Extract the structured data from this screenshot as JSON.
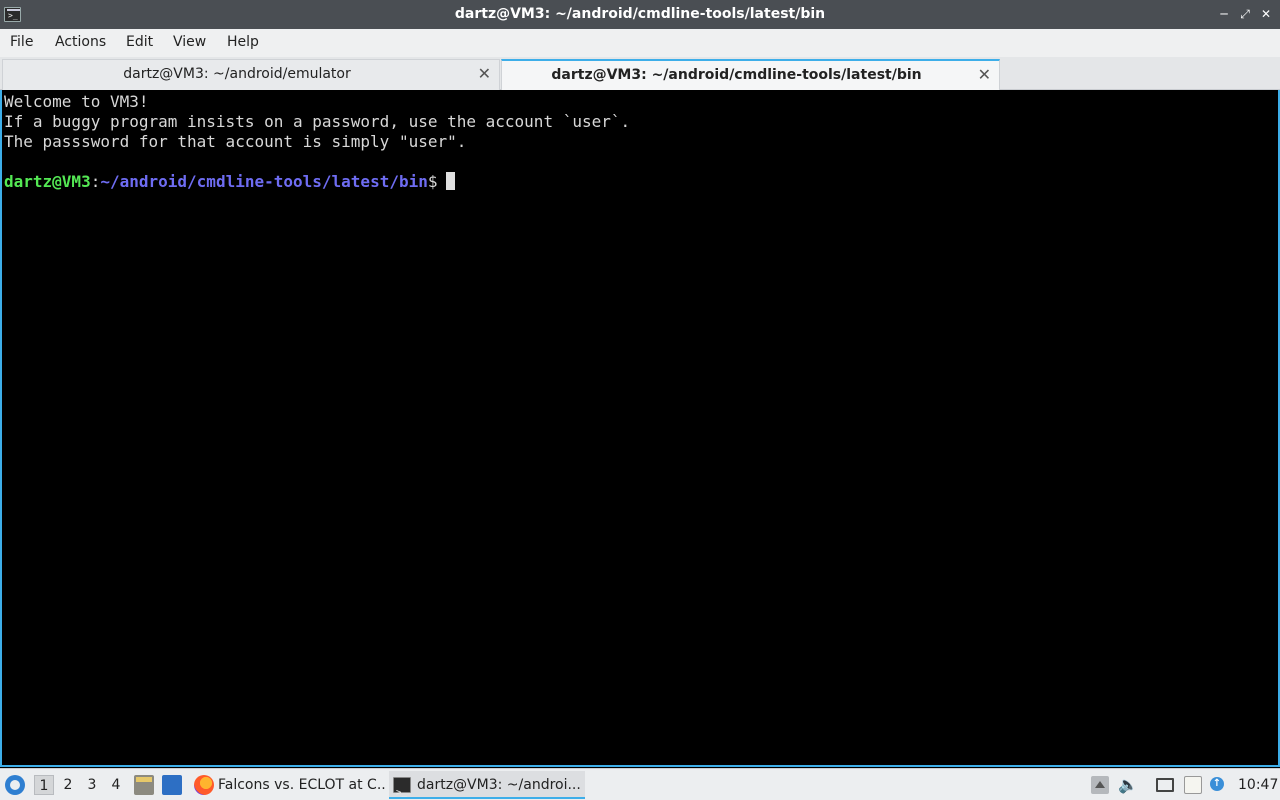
{
  "window": {
    "title": "dartz@VM3: ~/android/cmdline-tools/latest/bin",
    "icon": "terminal-icon",
    "controls": [
      "minimize",
      "maximize",
      "close"
    ]
  },
  "menu": {
    "items": [
      "File",
      "Actions",
      "Edit",
      "View",
      "Help"
    ]
  },
  "tabs": [
    {
      "label": "dartz@VM3: ~/android/emulator",
      "active": false
    },
    {
      "label": "dartz@VM3: ~/android/cmdline-tools/latest/bin",
      "active": true
    }
  ],
  "terminal": {
    "lines": [
      "Welcome to VM3!",
      "If a buggy program insists on a password, use the account `user`.",
      "The passsword for that account is simply \"user\".",
      ""
    ],
    "prompt": {
      "user_host": "dartz@VM3",
      "colon": ":",
      "path": "~/android/cmdline-tools/latest/bin",
      "sign": "$"
    },
    "colors": {
      "user": "#54e854",
      "path": "#6e6cf2",
      "background": "#000000",
      "text": "#d8d8d8"
    }
  },
  "taskbar": {
    "workspaces": [
      "1",
      "2",
      "3",
      "4"
    ],
    "active_workspace": "1",
    "tasks": [
      {
        "label": "Falcons vs. ECLOT at C...",
        "icon": "firefox-icon",
        "active": false
      },
      {
        "label": "dartz@VM3: ~/androi...",
        "icon": "terminal-icon",
        "active": true
      }
    ],
    "clock": "10:47"
  }
}
